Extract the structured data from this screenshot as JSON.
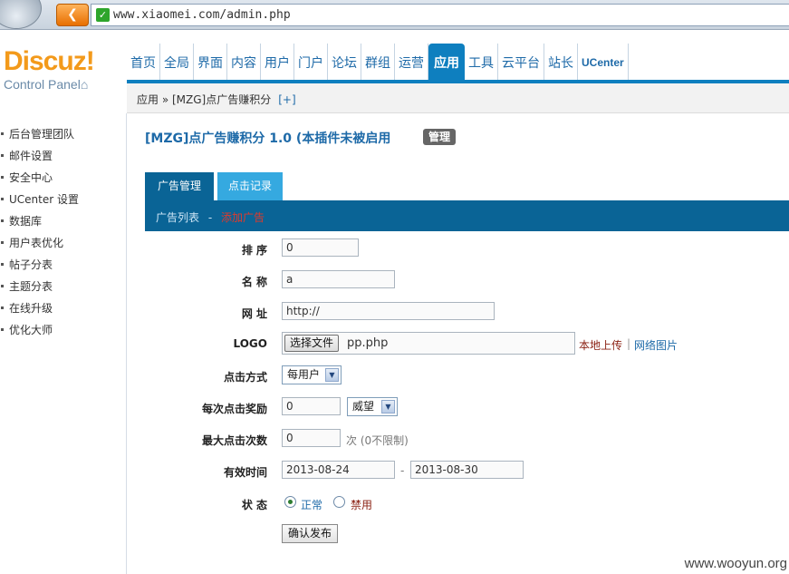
{
  "browser": {
    "url": "www.xiaomei.com/admin.php"
  },
  "logo": {
    "brand": "Discuz!",
    "subtitle": "Control Panel",
    "home_glyph": "⌂"
  },
  "topnav": {
    "items": [
      "首页",
      "全局",
      "界面",
      "内容",
      "用户",
      "门户",
      "论坛",
      "群组",
      "运营",
      "应用",
      "工具",
      "云平台",
      "站长",
      "UCenter"
    ],
    "active": "应用"
  },
  "breadcrumb": {
    "text": "应用 » [MZG]点广告赚积分",
    "plus": "[+]"
  },
  "sidebar": {
    "items": [
      "后台管理团队",
      "邮件设置",
      "安全中心",
      "UCenter 设置",
      "数据库",
      "用户表优化",
      "帖子分表",
      "主题分表",
      "在线升级",
      "优化大师"
    ]
  },
  "page": {
    "title": "[MZG]点广告赚积分 1.0 (本插件未被启用",
    "manage_badge": "管理"
  },
  "tabs": {
    "ad_manage": "广告管理",
    "click_log": "点击记录"
  },
  "subbar": {
    "list": "广告列表",
    "sep": "-",
    "current": "添加广告"
  },
  "form": {
    "order": {
      "label": "排 序",
      "value": "0"
    },
    "name": {
      "label": "名 称",
      "value": "a"
    },
    "url": {
      "label": "网 址",
      "value": "http://"
    },
    "logo": {
      "label": "LOGO",
      "button": "选择文件",
      "file": "pp.php",
      "upload_link": "本地上传",
      "link_sep": "|",
      "net_link": "网络图片"
    },
    "click_mode": {
      "label": "点击方式",
      "selected": "每用户"
    },
    "reward": {
      "label": "每次点击奖励",
      "value": "0",
      "credit": "威望"
    },
    "max_clicks": {
      "label": "最大点击次数",
      "value": "0",
      "hint": "次 (0不限制)"
    },
    "valid": {
      "label": "有效时间",
      "start": "2013-08-24",
      "sep": "-",
      "end": "2013-08-30"
    },
    "status": {
      "label": "状 态",
      "normal": "正常",
      "disabled": "禁用"
    },
    "submit": "确认发布"
  },
  "watermark": "www.wooyun.org",
  "colors": {
    "accent": "#0e7fbf",
    "brand_orange": "#f39a1b",
    "tab_dark": "#0a6496",
    "tab_light": "#35a9e0"
  }
}
